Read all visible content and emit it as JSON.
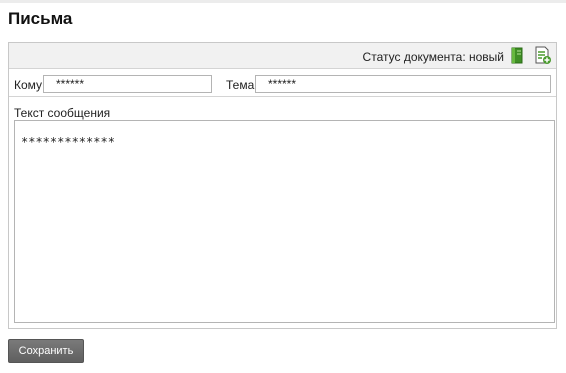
{
  "page": {
    "title": "Письма"
  },
  "status_bar": {
    "status_text": "Статус документа: новый",
    "icons": [
      "book-icon",
      "add-document-icon"
    ]
  },
  "form": {
    "to_label": "Кому",
    "to_value": "******",
    "subject_label": "Тема",
    "subject_value": "******",
    "message_label": "Текст сообщения",
    "message_value": "*************"
  },
  "actions": {
    "save_label": "Сохранить"
  },
  "colors": {
    "icon_green": "#4a9a2e",
    "button_gray": "#6a6a6a",
    "panel_header": "#f1f1f1"
  }
}
